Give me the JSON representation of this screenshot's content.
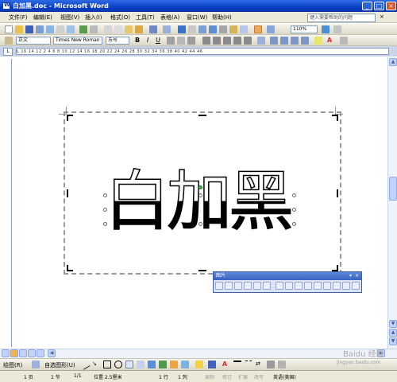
{
  "window": {
    "title": "白加黑.doc - Microsoft Word"
  },
  "menu": [
    "文件(F)",
    "编辑(E)",
    "视图(V)",
    "插入(I)",
    "格式(O)",
    "工具(T)",
    "表格(A)",
    "窗口(W)",
    "帮助(H)"
  ],
  "help_placeholder": "键入需要帮助的问题",
  "toolbar": {
    "zoom": "110%"
  },
  "format": {
    "style": "正文",
    "font": "Times New Roman",
    "size": "五号"
  },
  "ruler_text": "L  16 14 12    2  4  6  8  10  12  14  16  18  20  22  24  26  28  30  32  34  36  38  40   42  44  46",
  "document": {
    "wordart_text": "白加黑"
  },
  "picture_toolbar": {
    "title": "图片"
  },
  "drawing_toolbar": {
    "draw_label": "绘图(R)",
    "autoshapes_label": "自选图形(U)"
  },
  "status": {
    "page": "1 页",
    "section": "1 节",
    "page_of": "1/1",
    "position": "位置 2.5厘米",
    "line": "1 行",
    "col": "1 列",
    "rec": "录制",
    "trk": "修订",
    "ext": "扩展",
    "ovr": "改写",
    "lang": "英语(美国)"
  },
  "watermark": {
    "site": "Baidu 经验",
    "url": "jingyan.baidu.com"
  },
  "colors": {
    "titlebar": "#0a3fc4",
    "chrome": "#ece9d8",
    "picbar": "#3a64c3"
  }
}
